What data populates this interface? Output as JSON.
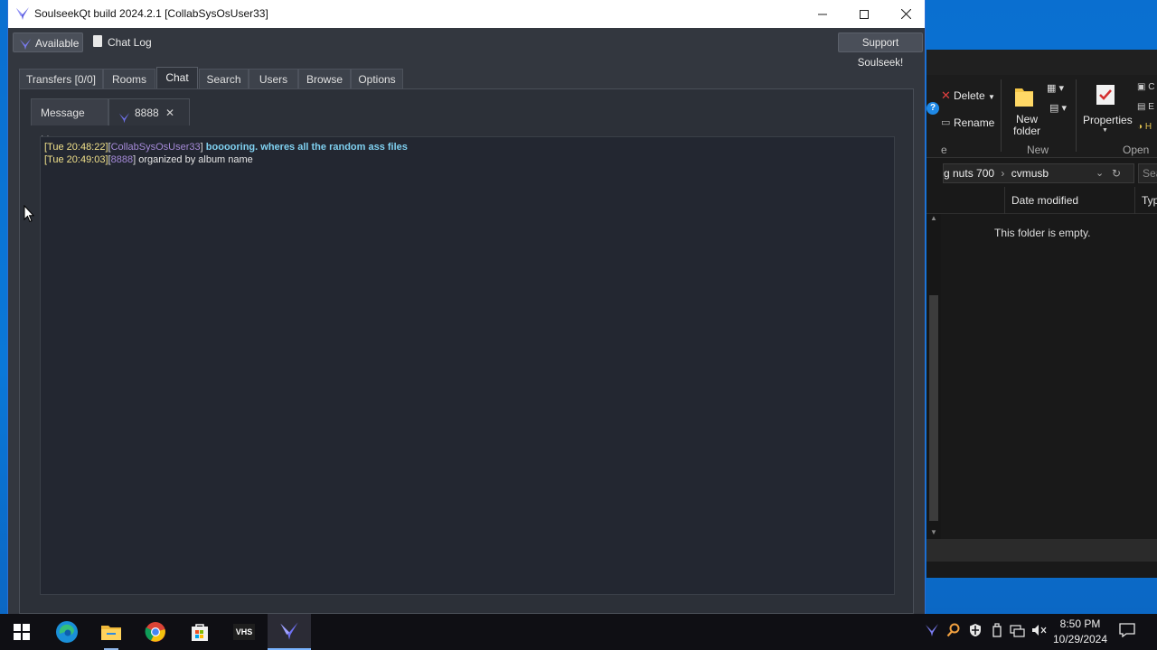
{
  "window": {
    "title": "SoulseekQt build 2024.2.1 [CollabSysOsUser33]"
  },
  "toolbar": {
    "status_label": "Available",
    "chat_log_label": "Chat Log",
    "support_label": "Support Soulseek!"
  },
  "tabs": [
    {
      "label": "Transfers [0/0]"
    },
    {
      "label": "Rooms"
    },
    {
      "label": "Chat"
    },
    {
      "label": "Search"
    },
    {
      "label": "Users"
    },
    {
      "label": "Browse"
    },
    {
      "label": "Options"
    }
  ],
  "active_tab": "Chat",
  "subtabs": [
    {
      "label": "Message List"
    },
    {
      "label": "8888"
    }
  ],
  "chat": {
    "messages": [
      {
        "time": "[Tue 20:48:22]",
        "user": "CollabSysOsUser33",
        "text": "booooring. wheres all the random ass files"
      },
      {
        "time": "[Tue 20:49:03]",
        "user": "8888",
        "text": "organized by album name"
      }
    ]
  },
  "explorer": {
    "ribbon": {
      "delete_label": "Delete",
      "rename_label": "Rename",
      "new_folder_label_1": "New",
      "new_folder_label_2": "folder",
      "new_group_label": "New",
      "properties_label": "Properties",
      "open_group_label": "Open",
      "partial_left_label": "e"
    },
    "address": {
      "crumb_1": "g nuts 700",
      "crumb_2": "cvmusb",
      "search_placeholder": "Sear"
    },
    "column_date": "Date modified",
    "column_type": "Typ",
    "empty_text": "This folder is empty."
  },
  "taskbar": {
    "clock_time": "8:50 PM",
    "clock_date": "10/29/2024",
    "vhs_label": "VHS"
  },
  "colors": {
    "accent": "#2e7fd0",
    "timestamp": "#f0e08a",
    "username": "#a58ad8",
    "own_message": "#7fd0f0"
  }
}
